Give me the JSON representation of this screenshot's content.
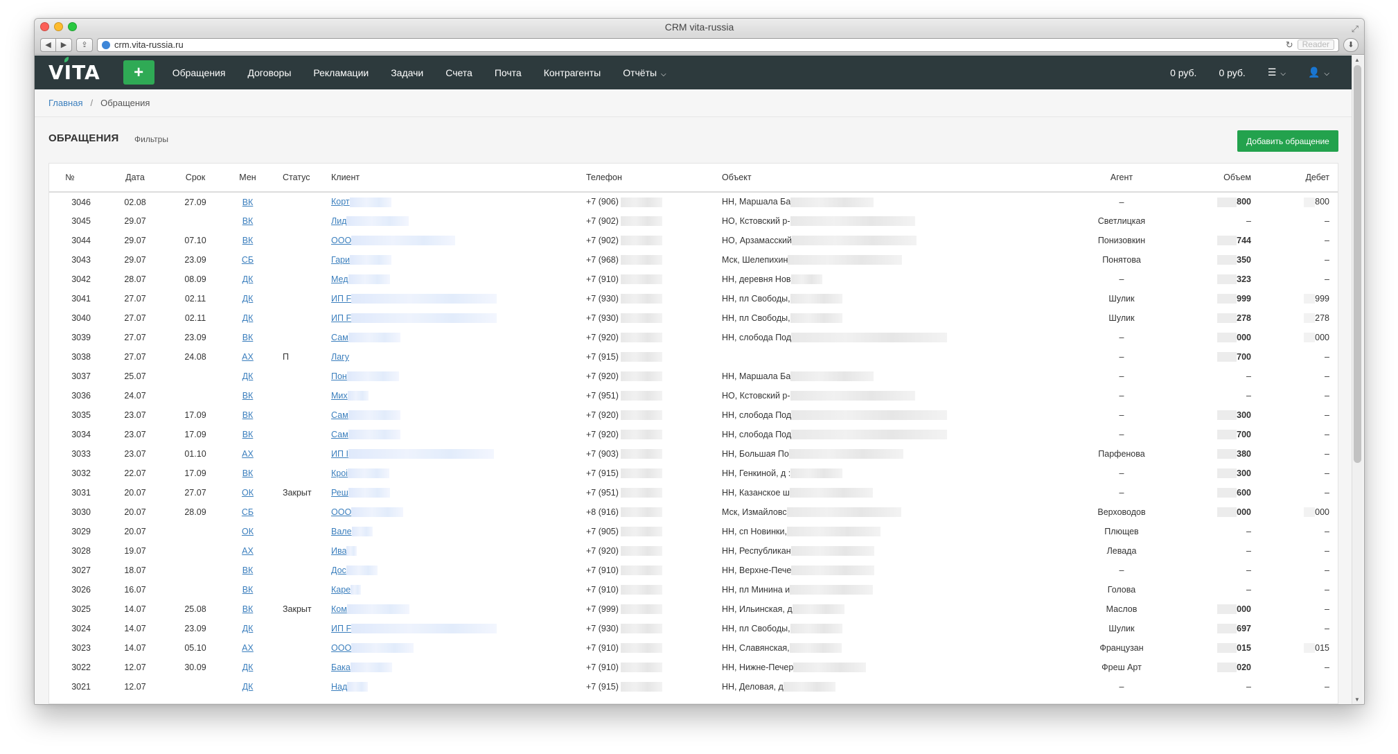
{
  "window": {
    "title": "CRM vita-russia"
  },
  "browser": {
    "url": "crm.vita-russia.ru",
    "reader_label": "Reader"
  },
  "nav": {
    "logo": "VITA",
    "plus": "+",
    "links": [
      "Обращения",
      "Договоры",
      "Рекламации",
      "Задачи",
      "Счета",
      "Почта",
      "Контрагенты"
    ],
    "reports": "Отчёты",
    "balance1": "0 руб.",
    "balance2": "0 руб."
  },
  "breadcrumb": {
    "home": "Главная",
    "current": "Обращения"
  },
  "section": {
    "title": "ОБРАЩЕНИЯ",
    "filters": "Фильтры",
    "add_button": "Добавить обращение"
  },
  "table": {
    "headers": [
      "№",
      "Дата",
      "Срок",
      "Мен",
      "Статус",
      "Клиент",
      "Телефон",
      "Объект",
      "Агент",
      "Объем",
      "Дебет"
    ],
    "rows": [
      {
        "id": "3046",
        "date": "02.08",
        "due": "27.09",
        "mgr": "ВК",
        "status": "",
        "client": "Корт",
        "phone": "+7 (906)",
        "object": "НН, Маршала Ба",
        "agent": "–",
        "volume": "800",
        "debit": "800"
      },
      {
        "id": "3045",
        "date": "29.07",
        "due": "",
        "mgr": "ВК",
        "status": "",
        "client": "Лид",
        "phone": "+7 (902)",
        "object": "НО, Кстовский р-",
        "agent": "Светлицкая",
        "volume": "–",
        "debit": "–"
      },
      {
        "id": "3044",
        "date": "29.07",
        "due": "07.10",
        "mgr": "ВК",
        "status": "",
        "client": "ООО",
        "phone": "+7 (902)",
        "object": "НО, Арзамасский",
        "agent": "Понизовкин",
        "volume": "744",
        "debit": "–"
      },
      {
        "id": "3043",
        "date": "29.07",
        "due": "23.09",
        "mgr": "СБ",
        "status": "",
        "client": "Гари",
        "phone": "+7 (968)",
        "object": "Мск, Шелепихин",
        "agent": "Понятова",
        "volume": "350",
        "debit": "–"
      },
      {
        "id": "3042",
        "date": "28.07",
        "due": "08.09",
        "mgr": "ДК",
        "status": "",
        "client": "Мед",
        "phone": "+7 (910)",
        "object": "НН, деревня Нов",
        "agent": "–",
        "volume": "323",
        "debit": "–"
      },
      {
        "id": "3041",
        "date": "27.07",
        "due": "02.11",
        "mgr": "ДК",
        "status": "",
        "client": "ИП F",
        "phone": "+7 (930)",
        "object": "НН, пл Свободы,",
        "agent": "Шулик",
        "volume": "999",
        "debit": "999"
      },
      {
        "id": "3040",
        "date": "27.07",
        "due": "02.11",
        "mgr": "ДК",
        "status": "",
        "client": "ИП F",
        "phone": "+7 (930)",
        "object": "НН, пл Свободы,",
        "agent": "Шулик",
        "volume": "278",
        "debit": "278"
      },
      {
        "id": "3039",
        "date": "27.07",
        "due": "23.09",
        "mgr": "ВК",
        "status": "",
        "client": "Сам",
        "phone": "+7 (920)",
        "object": "НН, слобода Под",
        "agent": "–",
        "volume": "000",
        "debit": "000"
      },
      {
        "id": "3038",
        "date": "27.07",
        "due": "24.08",
        "mgr": "АХ",
        "status": "П",
        "client": "Лагу",
        "phone": "+7 (915)",
        "object": "",
        "agent": "–",
        "volume": "700",
        "debit": "–"
      },
      {
        "id": "3037",
        "date": "25.07",
        "due": "",
        "mgr": "ДК",
        "status": "",
        "client": "Пон",
        "phone": "+7 (920)",
        "object": "НН, Маршала Ба",
        "agent": "–",
        "volume": "–",
        "debit": "–"
      },
      {
        "id": "3036",
        "date": "24.07",
        "due": "",
        "mgr": "ВК",
        "status": "",
        "client": "Мих",
        "phone": "+7 (951)",
        "object": "НО, Кстовский р-",
        "agent": "–",
        "volume": "–",
        "debit": "–"
      },
      {
        "id": "3035",
        "date": "23.07",
        "due": "17.09",
        "mgr": "ВК",
        "status": "",
        "client": "Сам",
        "phone": "+7 (920)",
        "object": "НН, слобода Под",
        "agent": "–",
        "volume": "300",
        "debit": "–"
      },
      {
        "id": "3034",
        "date": "23.07",
        "due": "17.09",
        "mgr": "ВК",
        "status": "",
        "client": "Сам",
        "phone": "+7 (920)",
        "object": "НН, слобода Под",
        "agent": "–",
        "volume": "700",
        "debit": "–"
      },
      {
        "id": "3033",
        "date": "23.07",
        "due": "01.10",
        "mgr": "АХ",
        "status": "",
        "client": "ИП І",
        "phone": "+7 (903)",
        "object": "НН, Большая По",
        "agent": "Парфенова",
        "volume": "380",
        "debit": "–"
      },
      {
        "id": "3032",
        "date": "22.07",
        "due": "17.09",
        "mgr": "ВК",
        "status": "",
        "client": "Кроі",
        "phone": "+7 (915)",
        "object": "НН, Генкиной, д :",
        "agent": "–",
        "volume": "300",
        "debit": "–"
      },
      {
        "id": "3031",
        "date": "20.07",
        "due": "27.07",
        "mgr": "ОК",
        "status": "Закрыт",
        "client": "Реш",
        "phone": "+7 (951)",
        "object": "НН, Казанское ш",
        "agent": "–",
        "volume": "600",
        "debit": "–"
      },
      {
        "id": "3030",
        "date": "20.07",
        "due": "28.09",
        "mgr": "СБ",
        "status": "",
        "client": "ООО",
        "phone": "+8 (916)",
        "object": "Мск, Измайловс",
        "agent": "Верховодов",
        "volume": "000",
        "debit": "000"
      },
      {
        "id": "3029",
        "date": "20.07",
        "due": "",
        "mgr": "ОК",
        "status": "",
        "client": "Вале",
        "phone": "+7 (905)",
        "object": "НН, сп Новинки,",
        "agent": "Плющев",
        "volume": "–",
        "debit": "–"
      },
      {
        "id": "3028",
        "date": "19.07",
        "due": "",
        "mgr": "АХ",
        "status": "",
        "client": "Ива",
        "phone": "+7 (920)",
        "object": "НН, Республикан",
        "agent": "Левада",
        "volume": "–",
        "debit": "–"
      },
      {
        "id": "3027",
        "date": "18.07",
        "due": "",
        "mgr": "ВК",
        "status": "",
        "client": "Дос",
        "phone": "+7 (910)",
        "object": "НН, Верхне-Пече",
        "agent": "–",
        "volume": "–",
        "debit": "–"
      },
      {
        "id": "3026",
        "date": "16.07",
        "due": "",
        "mgr": "ВК",
        "status": "",
        "client": "Каре",
        "phone": "+7 (910)",
        "object": "НН, пл Минина и",
        "agent": "Голова",
        "volume": "–",
        "debit": "–"
      },
      {
        "id": "3025",
        "date": "14.07",
        "due": "25.08",
        "mgr": "ВК",
        "status": "Закрыт",
        "client": "Ком",
        "phone": "+7 (999)",
        "object": "НН, Ильинская, д",
        "agent": "Маслов",
        "volume": "000",
        "debit": "–"
      },
      {
        "id": "3024",
        "date": "14.07",
        "due": "23.09",
        "mgr": "ДК",
        "status": "",
        "client": "ИП F",
        "phone": "+7 (930)",
        "object": "НН, пл Свободы,",
        "agent": "Шулик",
        "volume": "697",
        "debit": "–"
      },
      {
        "id": "3023",
        "date": "14.07",
        "due": "05.10",
        "mgr": "АХ",
        "status": "",
        "client": "ООО",
        "phone": "+7 (910)",
        "object": "НН, Славянская,",
        "agent": "Французан",
        "volume": "015",
        "debit": "015"
      },
      {
        "id": "3022",
        "date": "12.07",
        "due": "30.09",
        "mgr": "ДК",
        "status": "",
        "client": "Бака",
        "phone": "+7 (910)",
        "object": "НН, Нижне-Печер",
        "agent": "Фреш Арт",
        "volume": "020",
        "debit": "–"
      },
      {
        "id": "3021",
        "date": "12.07",
        "due": "",
        "mgr": "ДК",
        "status": "",
        "client": "Над",
        "phone": "+7 (915)",
        "object": "НН, Деловая, д",
        "agent": "–",
        "volume": "–",
        "debit": "–"
      }
    ]
  },
  "colors": {
    "nav_bg": "#2d3a3d",
    "accent_green": "#23a24d",
    "link": "#3a7ebd"
  }
}
